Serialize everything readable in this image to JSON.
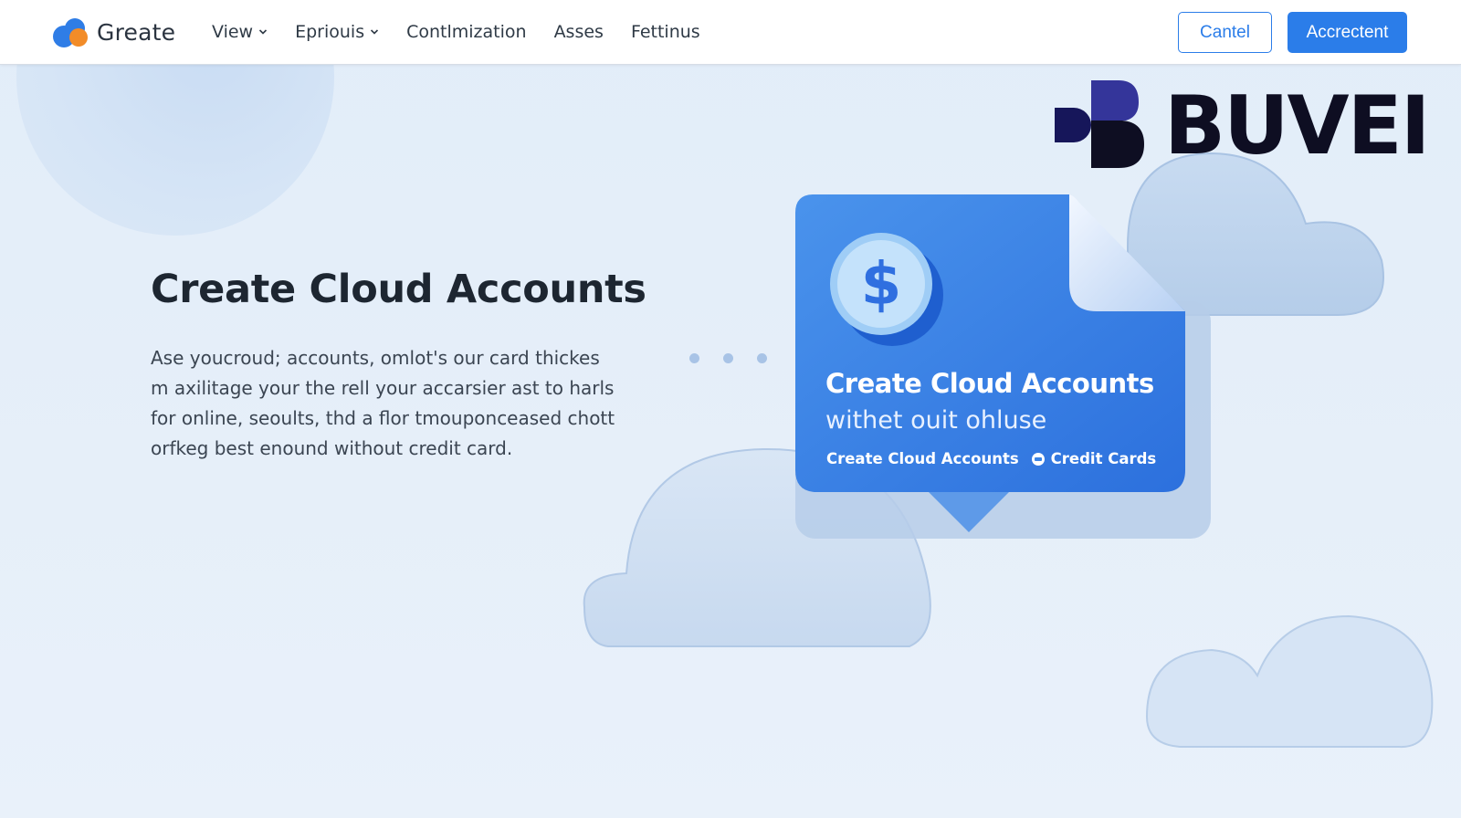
{
  "nav": {
    "brand": "Greate",
    "items": [
      {
        "label": "View",
        "has_dropdown": true
      },
      {
        "label": "Eprіouis",
        "has_dropdown": true
      },
      {
        "label": "Contlmization",
        "has_dropdown": false
      },
      {
        "label": "Asses",
        "has_dropdown": false
      },
      {
        "label": "Fettinus",
        "has_dropdown": false
      }
    ],
    "cancel_label": "Cantel",
    "accept_label": "Accrectent"
  },
  "hero": {
    "title": "Create Cloud Accounts",
    "body_lines": [
      "Ase youcroud; accounts, omlot's our card thickes",
      "m axilitage your the rell your accarsier ast to harls",
      "for online, seoults, thd a flor tmouponceased chott",
      "orfkeg best enound without credit card."
    ]
  },
  "brand_mark": {
    "text": "BUVEI"
  },
  "card": {
    "coin_symbol": "$",
    "title": "Create Cloud Accounts",
    "subtitle": "withet ouit ohluse",
    "footer_left": "Create Cloud Accounts",
    "footer_right": "Credit Cards"
  },
  "colors": {
    "accent": "#2b7de9",
    "background": "#e4eef9",
    "card_blue": "#3a84e6",
    "brand_dark": "#0e0e22"
  }
}
